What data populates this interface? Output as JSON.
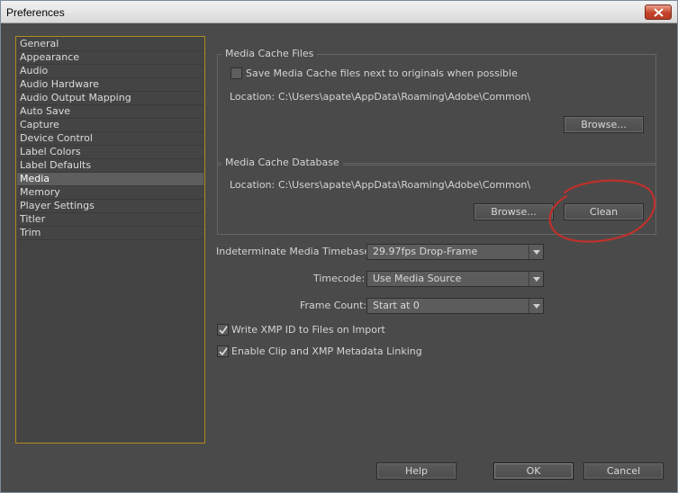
{
  "window": {
    "title": "Preferences"
  },
  "sidebar": {
    "items": [
      "General",
      "Appearance",
      "Audio",
      "Audio Hardware",
      "Audio Output Mapping",
      "Auto Save",
      "Capture",
      "Device Control",
      "Label Colors",
      "Label Defaults",
      "Media",
      "Memory",
      "Player Settings",
      "Titler",
      "Trim"
    ],
    "selected": "Media"
  },
  "media_cache_files": {
    "title": "Media Cache Files",
    "checkbox_label": "Save Media Cache files next to originals when possible",
    "checkbox_checked": false,
    "location_label": "Location:",
    "location_value": "C:\\Users\\apate\\AppData\\Roaming\\Adobe\\Common\\",
    "browse_label": "Browse..."
  },
  "media_cache_database": {
    "title": "Media Cache Database",
    "location_label": "Location:",
    "location_value": "C:\\Users\\apate\\AppData\\Roaming\\Adobe\\Common\\",
    "browse_label": "Browse...",
    "clean_label": "Clean"
  },
  "settings": {
    "timebase_label": "Indeterminate Media Timebase:",
    "timebase_value": "29.97fps Drop-Frame",
    "timecode_label": "Timecode:",
    "timecode_value": "Use Media Source",
    "frame_count_label": "Frame Count:",
    "frame_count_value": "Start at 0",
    "xmp_id_label": "Write XMP ID to Files on Import",
    "xmp_id_checked": true,
    "clip_xmp_label": "Enable Clip and XMP Metadata Linking",
    "clip_xmp_checked": true
  },
  "footer": {
    "help": "Help",
    "ok": "OK",
    "cancel": "Cancel"
  },
  "annotation": {
    "color": "#c0302a"
  }
}
